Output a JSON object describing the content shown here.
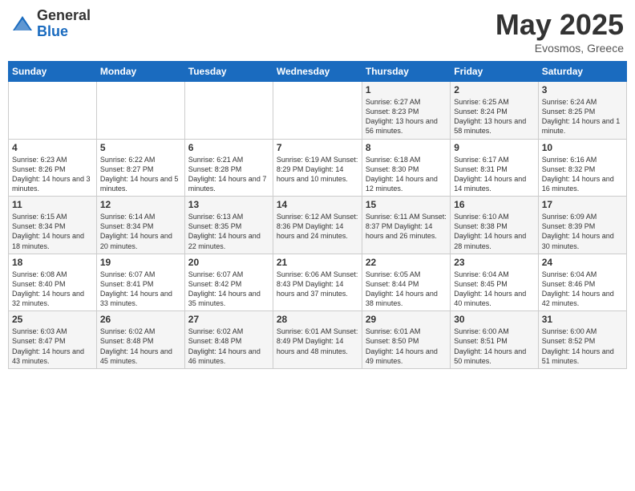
{
  "header": {
    "logo_general": "General",
    "logo_blue": "Blue",
    "title": "May 2025",
    "location": "Evosmos, Greece"
  },
  "calendar": {
    "days_of_week": [
      "Sunday",
      "Monday",
      "Tuesday",
      "Wednesday",
      "Thursday",
      "Friday",
      "Saturday"
    ],
    "weeks": [
      [
        {
          "day": "",
          "info": ""
        },
        {
          "day": "",
          "info": ""
        },
        {
          "day": "",
          "info": ""
        },
        {
          "day": "",
          "info": ""
        },
        {
          "day": "1",
          "info": "Sunrise: 6:27 AM\nSunset: 8:23 PM\nDaylight: 13 hours\nand 56 minutes."
        },
        {
          "day": "2",
          "info": "Sunrise: 6:25 AM\nSunset: 8:24 PM\nDaylight: 13 hours\nand 58 minutes."
        },
        {
          "day": "3",
          "info": "Sunrise: 6:24 AM\nSunset: 8:25 PM\nDaylight: 14 hours\nand 1 minute."
        }
      ],
      [
        {
          "day": "4",
          "info": "Sunrise: 6:23 AM\nSunset: 8:26 PM\nDaylight: 14 hours\nand 3 minutes."
        },
        {
          "day": "5",
          "info": "Sunrise: 6:22 AM\nSunset: 8:27 PM\nDaylight: 14 hours\nand 5 minutes."
        },
        {
          "day": "6",
          "info": "Sunrise: 6:21 AM\nSunset: 8:28 PM\nDaylight: 14 hours\nand 7 minutes."
        },
        {
          "day": "7",
          "info": "Sunrise: 6:19 AM\nSunset: 8:29 PM\nDaylight: 14 hours\nand 10 minutes."
        },
        {
          "day": "8",
          "info": "Sunrise: 6:18 AM\nSunset: 8:30 PM\nDaylight: 14 hours\nand 12 minutes."
        },
        {
          "day": "9",
          "info": "Sunrise: 6:17 AM\nSunset: 8:31 PM\nDaylight: 14 hours\nand 14 minutes."
        },
        {
          "day": "10",
          "info": "Sunrise: 6:16 AM\nSunset: 8:32 PM\nDaylight: 14 hours\nand 16 minutes."
        }
      ],
      [
        {
          "day": "11",
          "info": "Sunrise: 6:15 AM\nSunset: 8:34 PM\nDaylight: 14 hours\nand 18 minutes."
        },
        {
          "day": "12",
          "info": "Sunrise: 6:14 AM\nSunset: 8:34 PM\nDaylight: 14 hours\nand 20 minutes."
        },
        {
          "day": "13",
          "info": "Sunrise: 6:13 AM\nSunset: 8:35 PM\nDaylight: 14 hours\nand 22 minutes."
        },
        {
          "day": "14",
          "info": "Sunrise: 6:12 AM\nSunset: 8:36 PM\nDaylight: 14 hours\nand 24 minutes."
        },
        {
          "day": "15",
          "info": "Sunrise: 6:11 AM\nSunset: 8:37 PM\nDaylight: 14 hours\nand 26 minutes."
        },
        {
          "day": "16",
          "info": "Sunrise: 6:10 AM\nSunset: 8:38 PM\nDaylight: 14 hours\nand 28 minutes."
        },
        {
          "day": "17",
          "info": "Sunrise: 6:09 AM\nSunset: 8:39 PM\nDaylight: 14 hours\nand 30 minutes."
        }
      ],
      [
        {
          "day": "18",
          "info": "Sunrise: 6:08 AM\nSunset: 8:40 PM\nDaylight: 14 hours\nand 32 minutes."
        },
        {
          "day": "19",
          "info": "Sunrise: 6:07 AM\nSunset: 8:41 PM\nDaylight: 14 hours\nand 33 minutes."
        },
        {
          "day": "20",
          "info": "Sunrise: 6:07 AM\nSunset: 8:42 PM\nDaylight: 14 hours\nand 35 minutes."
        },
        {
          "day": "21",
          "info": "Sunrise: 6:06 AM\nSunset: 8:43 PM\nDaylight: 14 hours\nand 37 minutes."
        },
        {
          "day": "22",
          "info": "Sunrise: 6:05 AM\nSunset: 8:44 PM\nDaylight: 14 hours\nand 38 minutes."
        },
        {
          "day": "23",
          "info": "Sunrise: 6:04 AM\nSunset: 8:45 PM\nDaylight: 14 hours\nand 40 minutes."
        },
        {
          "day": "24",
          "info": "Sunrise: 6:04 AM\nSunset: 8:46 PM\nDaylight: 14 hours\nand 42 minutes."
        }
      ],
      [
        {
          "day": "25",
          "info": "Sunrise: 6:03 AM\nSunset: 8:47 PM\nDaylight: 14 hours\nand 43 minutes."
        },
        {
          "day": "26",
          "info": "Sunrise: 6:02 AM\nSunset: 8:48 PM\nDaylight: 14 hours\nand 45 minutes."
        },
        {
          "day": "27",
          "info": "Sunrise: 6:02 AM\nSunset: 8:48 PM\nDaylight: 14 hours\nand 46 minutes."
        },
        {
          "day": "28",
          "info": "Sunrise: 6:01 AM\nSunset: 8:49 PM\nDaylight: 14 hours\nand 48 minutes."
        },
        {
          "day": "29",
          "info": "Sunrise: 6:01 AM\nSunset: 8:50 PM\nDaylight: 14 hours\nand 49 minutes."
        },
        {
          "day": "30",
          "info": "Sunrise: 6:00 AM\nSunset: 8:51 PM\nDaylight: 14 hours\nand 50 minutes."
        },
        {
          "day": "31",
          "info": "Sunrise: 6:00 AM\nSunset: 8:52 PM\nDaylight: 14 hours\nand 51 minutes."
        }
      ]
    ]
  }
}
